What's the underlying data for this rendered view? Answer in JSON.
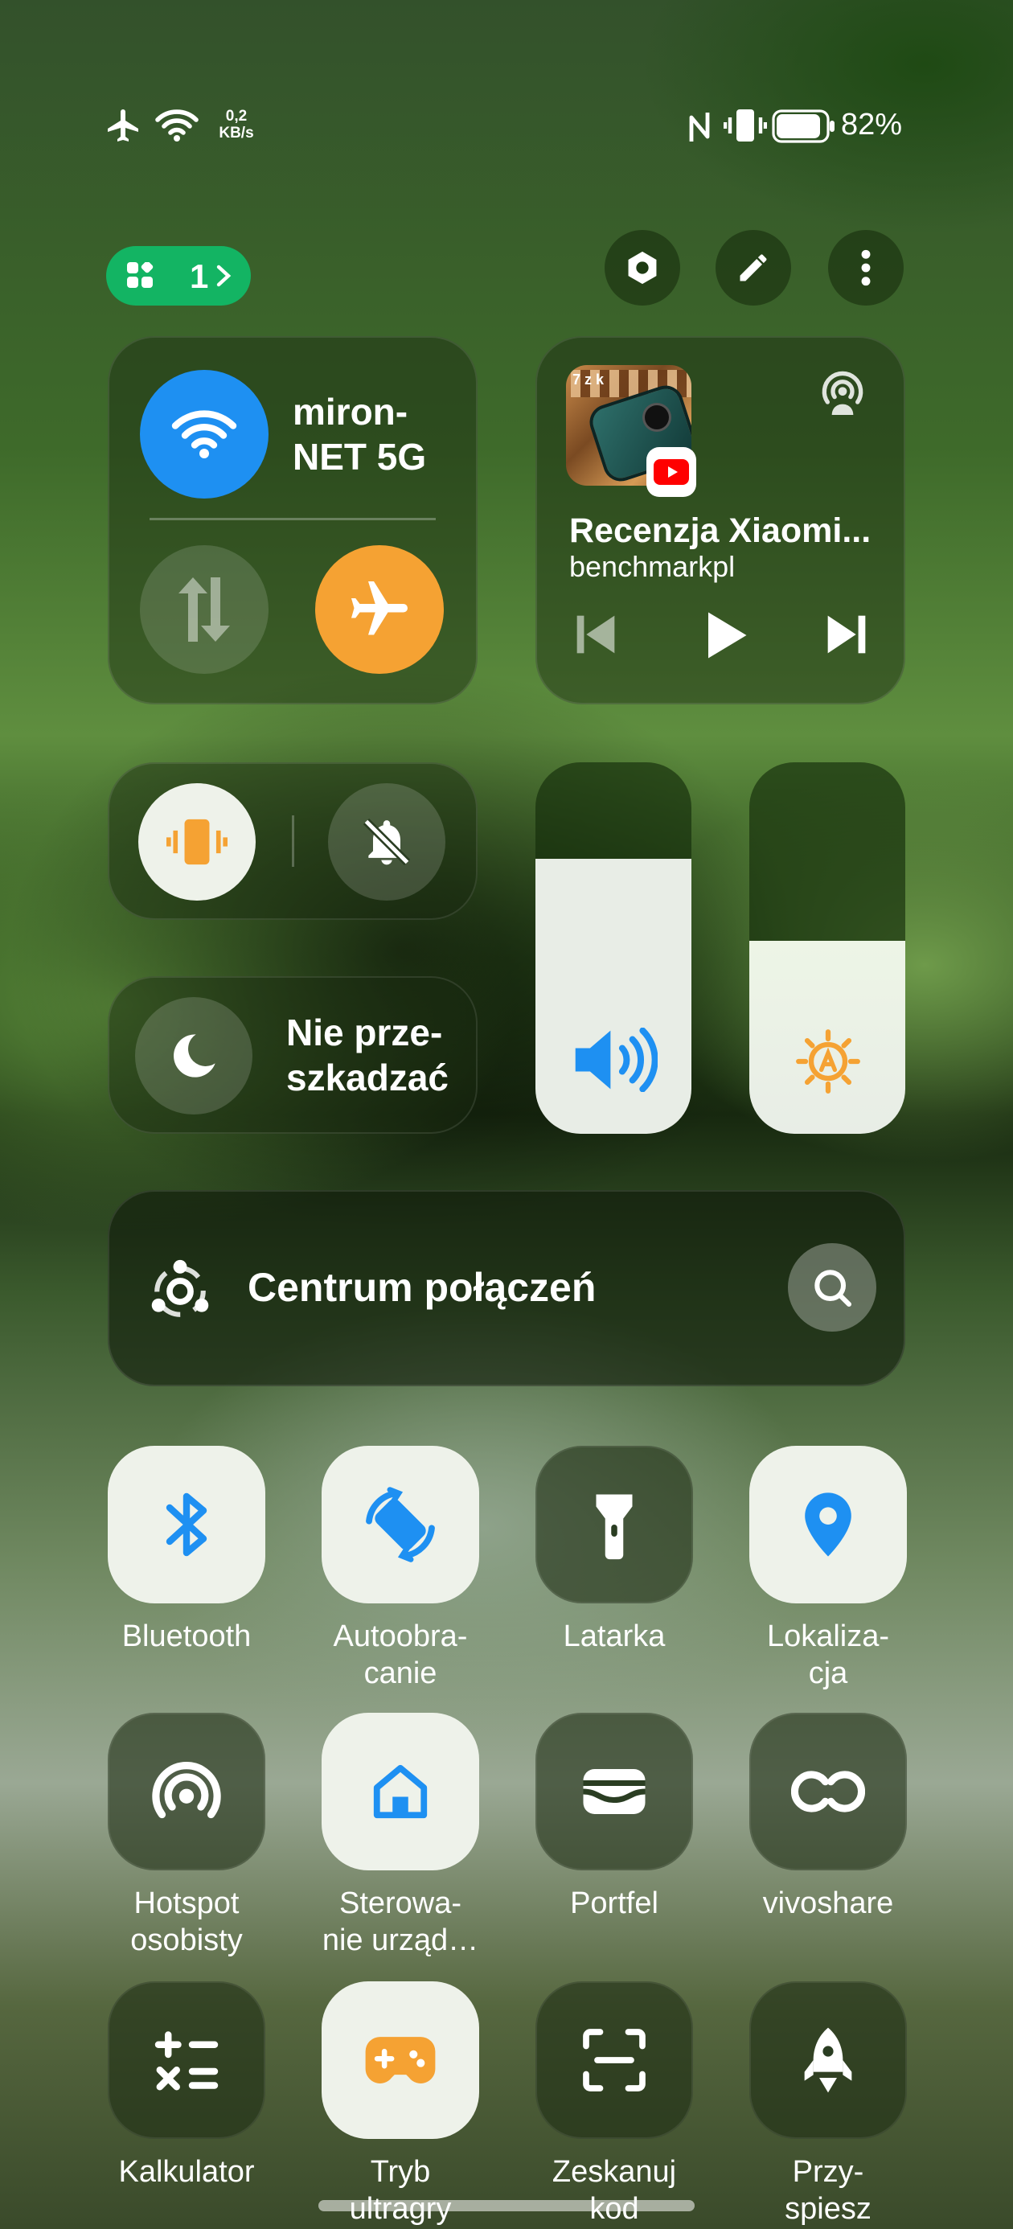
{
  "status_bar": {
    "speed_value": "0,2",
    "speed_unit": "KB/s",
    "battery": "82%",
    "icons": [
      "airplane-icon",
      "wifi-icon",
      "nfc-icon",
      "vibrate-icon",
      "battery-icon"
    ]
  },
  "header": {
    "page_badge": "1",
    "buttons": [
      "settings-icon",
      "edit-icon",
      "more-icon"
    ]
  },
  "network": {
    "wifi_name": "miron-\nNET 5G",
    "wifi_on": true,
    "mobile_data_on": false,
    "airplane_on": true
  },
  "media": {
    "title": "Recenzja Xiaomi...",
    "artist": "benchmarkpl",
    "thumbnail_text": "7 z k"
  },
  "sound_modes": {
    "vibrate_on": true,
    "mute_on": false
  },
  "dnd": {
    "label": "Nie prze-\nszkadzać",
    "on": false
  },
  "sliders": {
    "volume": 0.74,
    "brightness": 0.52
  },
  "connection_center": {
    "label": "Centrum połączeń"
  },
  "tiles": [
    {
      "label": "Bluetooth",
      "icon": "bluetooth-icon",
      "on": true
    },
    {
      "label": "Autoobra-\ncanie",
      "icon": "auto-rotate-icon",
      "on": true
    },
    {
      "label": "Latarka",
      "icon": "flashlight-icon",
      "on": false
    },
    {
      "label": "Lokaliza-\ncja",
      "icon": "location-icon",
      "on": true
    },
    {
      "label": "Hotspot\nosobisty",
      "icon": "hotspot-icon",
      "on": false
    },
    {
      "label": "Sterowa-\nnie urząd…",
      "icon": "home-icon",
      "on": true
    },
    {
      "label": "Portfel",
      "icon": "wallet-icon",
      "on": false
    },
    {
      "label": "vivoshare",
      "icon": "vivoshare-icon",
      "on": false
    },
    {
      "label": "Kalkulator",
      "icon": "calculator-icon",
      "on": false
    },
    {
      "label": "Tryb\nultragry",
      "icon": "gamepad-icon",
      "on": true
    },
    {
      "label": "Zeskanuj\nkod",
      "icon": "scan-icon",
      "on": false
    },
    {
      "label": "Przy-\nspiesz",
      "icon": "rocket-icon",
      "on": false
    }
  ],
  "colors": {
    "accent_blue": "#1e90f2",
    "accent_orange": "#f5a233",
    "badge_green": "#13b463",
    "tile_on": "#eef2ea"
  }
}
